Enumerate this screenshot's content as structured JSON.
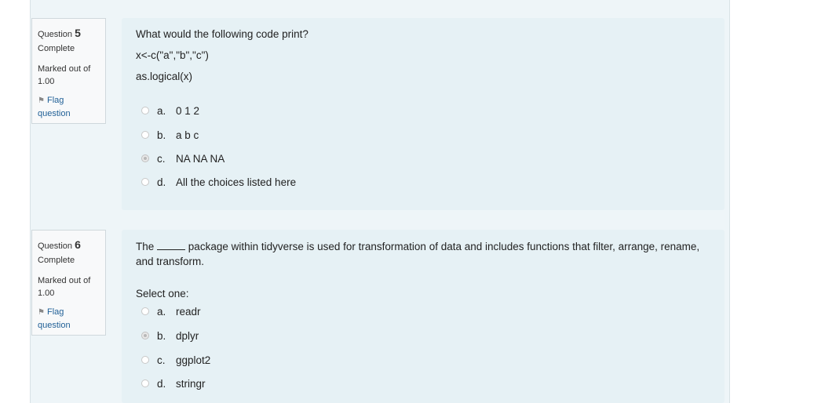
{
  "questions": [
    {
      "label": "Question",
      "number": "5",
      "state": "Complete",
      "marked_label": "Marked out of",
      "marked_value": "1.00",
      "flag_label": "Flag",
      "flag_label2": "question",
      "text_lines": [
        "What would the following code print?",
        "x<-c(\"a\",\"b\",\"c\")",
        "as.logical(x)"
      ],
      "options": [
        {
          "letter": "a.",
          "text": "0 1 2",
          "selected": false
        },
        {
          "letter": "b.",
          "text": "a b c",
          "selected": false
        },
        {
          "letter": "c.",
          "text": "NA NA NA",
          "selected": true
        },
        {
          "letter": "d.",
          "text": "All the choices listed here",
          "selected": false
        }
      ]
    },
    {
      "label": "Question",
      "number": "6",
      "state": "Complete",
      "marked_label": "Marked out of",
      "marked_value": "1.00",
      "flag_label": "Flag",
      "flag_label2": "question",
      "text_line1_pre": "The",
      "text_line1_post": "package within tidyverse is used for transformation of data and includes functions that filter, arrange, rename,",
      "text_line2": "and transform.",
      "select_one": "Select one:",
      "options": [
        {
          "letter": "a.",
          "text": "readr",
          "selected": false
        },
        {
          "letter": "b.",
          "text": "dplyr",
          "selected": true
        },
        {
          "letter": "c.",
          "text": "ggplot2",
          "selected": false
        },
        {
          "letter": "d.",
          "text": "stringr",
          "selected": false
        }
      ]
    }
  ]
}
